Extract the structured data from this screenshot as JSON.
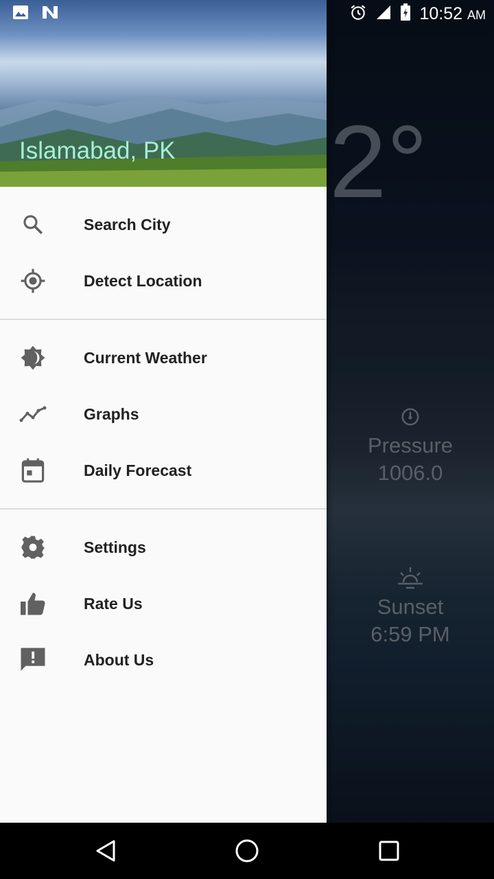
{
  "status_bar": {
    "time": "10:52",
    "ampm": "AM",
    "icons": [
      "image-icon",
      "n-app-icon",
      "alarm-icon",
      "signal-icon",
      "battery-icon"
    ]
  },
  "drawer": {
    "header_city": "Islamabad, PK",
    "sections": [
      [
        {
          "label": "Search City",
          "icon": "search-icon"
        },
        {
          "label": "Detect Location",
          "icon": "gps-icon"
        }
      ],
      [
        {
          "label": "Current Weather",
          "icon": "brightness-icon"
        },
        {
          "label": "Graphs",
          "icon": "graph-icon"
        },
        {
          "label": "Daily Forecast",
          "icon": "calendar-icon"
        }
      ],
      [
        {
          "label": "Settings",
          "icon": "gear-icon"
        },
        {
          "label": "Rate Us",
          "icon": "thumbs-up-icon"
        },
        {
          "label": "About Us",
          "icon": "feedback-icon"
        }
      ]
    ]
  },
  "background": {
    "temperature": "2°",
    "pressure_label": "Pressure",
    "pressure_value": "1006.0",
    "sunset_label": "Sunset",
    "sunset_value": "6:59 PM"
  },
  "colors": {
    "drawer_bg": "#fafafa",
    "city_text": "#a6f0d6",
    "menu_text": "#212121",
    "icon": "#616161"
  }
}
